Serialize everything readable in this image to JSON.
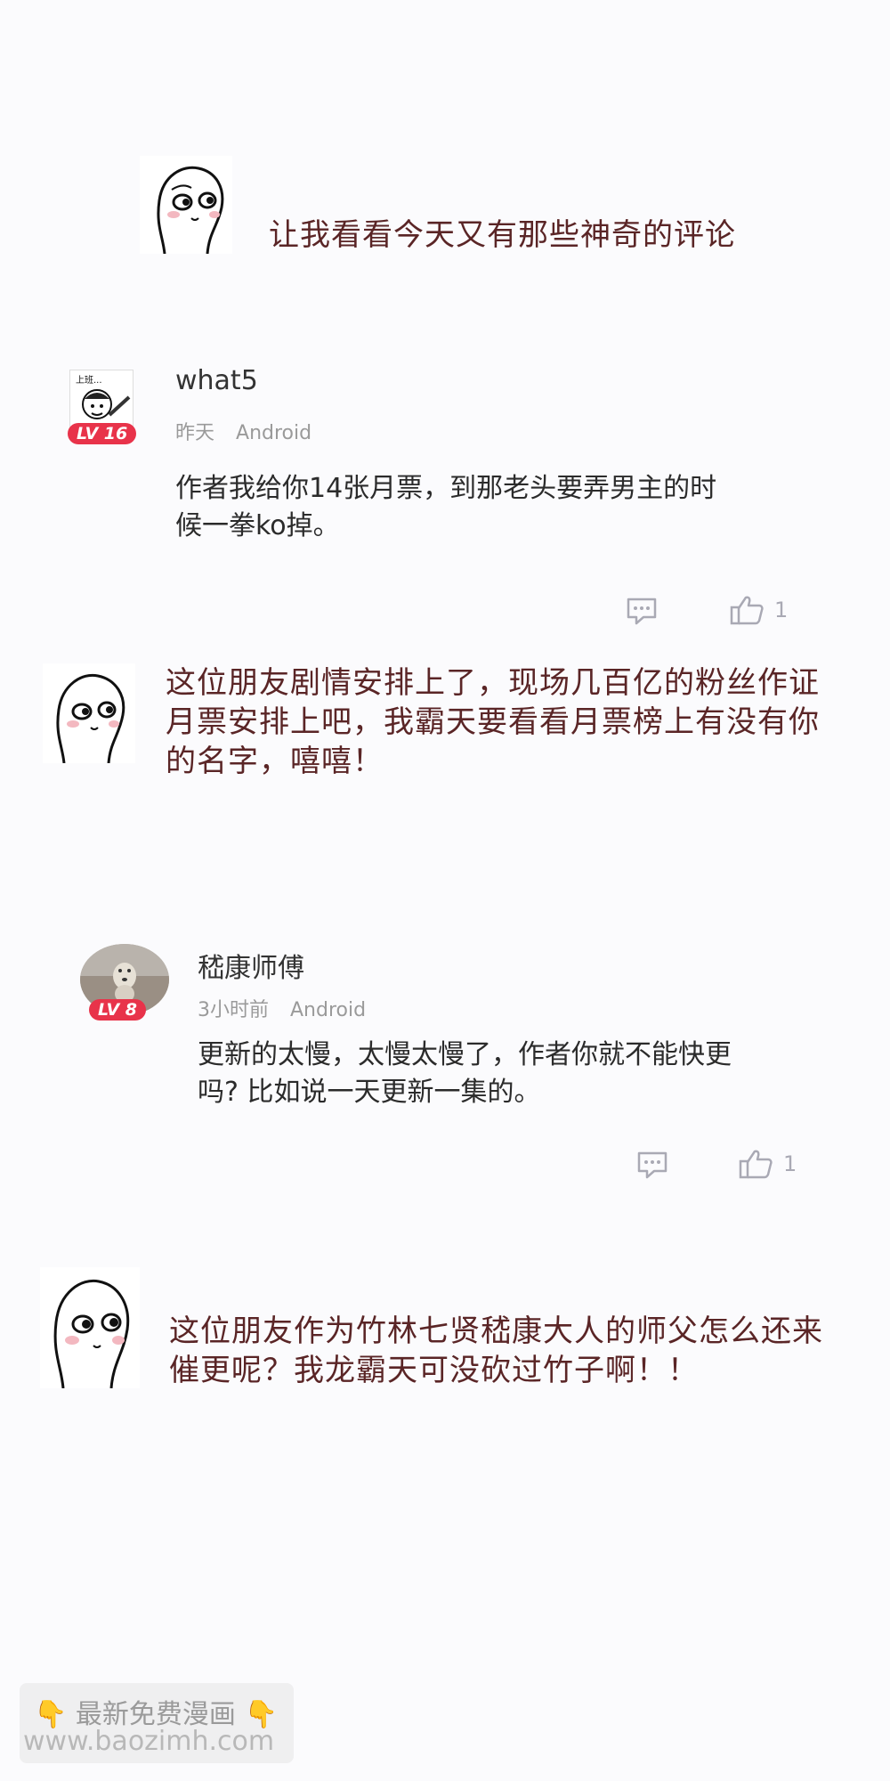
{
  "narration": {
    "line1": "让我看看今天又有那些神奇的评论",
    "reply1": [
      "这位朋友剧情安排上了，现场几百亿的粉丝作证",
      "月票安排上吧，我霸天要看看月票榜上有没有你",
      "的名字，嘻嘻！"
    ],
    "reply2": [
      "这位朋友作为竹林七贤嵇康大人的师父怎么还来",
      "催更呢？我龙霸天可没砍过竹子啊！！"
    ]
  },
  "comments": [
    {
      "username": "what5",
      "avatar_caption": "上班...",
      "level": "LV 16",
      "time": "昨天",
      "platform": "Android",
      "text": [
        "作者我给你14张月票，到那老头要弄男主的时",
        "候一拳ko掉。"
      ],
      "likes": "1"
    },
    {
      "username": "嵇康师傅",
      "level": "LV 8",
      "time": "3小时前",
      "platform": "Android",
      "text": [
        "更新的太慢，太慢太慢了，作者你就不能快更",
        "吗? 比如说一天更新一集的。"
      ],
      "likes": "1"
    }
  ],
  "watermark": {
    "title": "最新免费漫画",
    "url": "www.baozimh.com",
    "pointer_emoji": "👇"
  },
  "colors": {
    "narration": "#5a2526",
    "level_badge": "#e8334a",
    "background": "#fbfbfd"
  },
  "icons": [
    "meme-face-icon",
    "comment-icon",
    "thumbs-up-icon",
    "pointing-down-icon"
  ]
}
